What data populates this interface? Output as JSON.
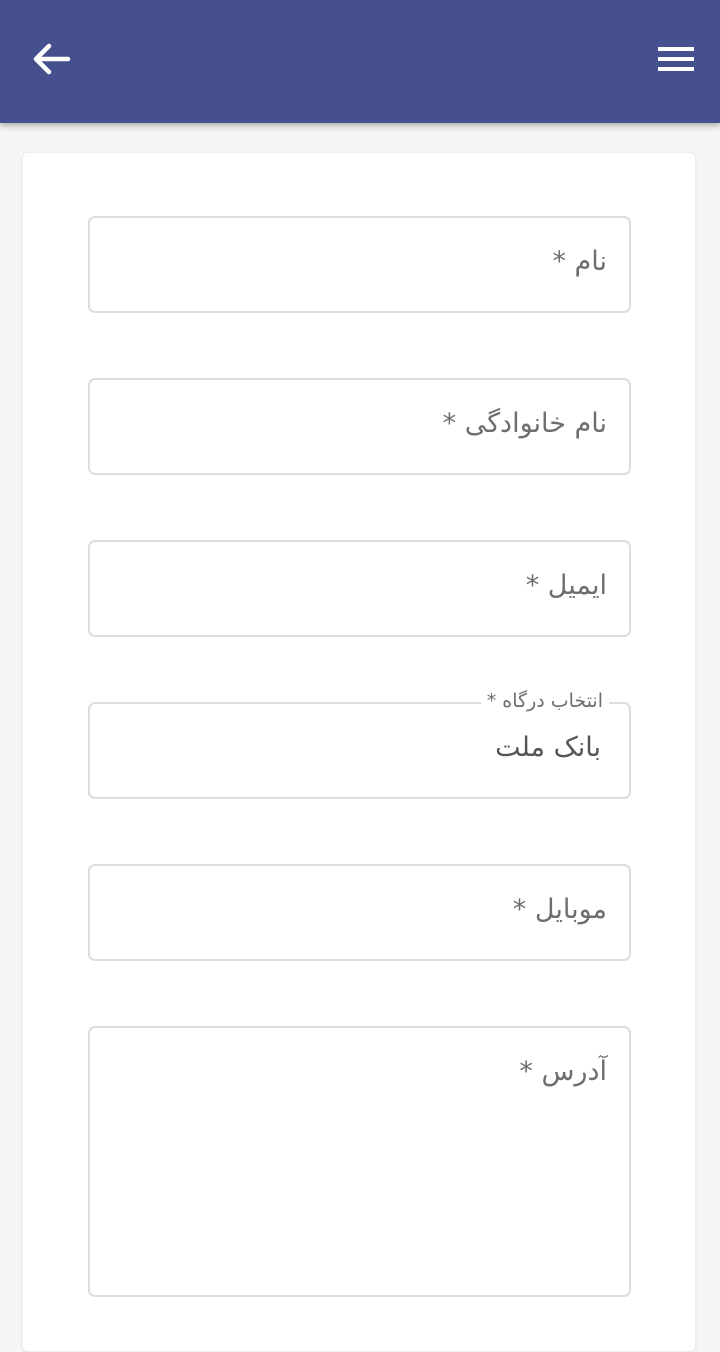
{
  "app_bar": {
    "background": "#46508f",
    "back_icon": "arrow-left-icon",
    "menu_icon": "hamburger-menu-icon"
  },
  "form": {
    "first_name": {
      "placeholder": "نام *"
    },
    "last_name": {
      "placeholder": "نام خانوادگی *"
    },
    "email": {
      "placeholder": "ایمیل *"
    },
    "gateway": {
      "label": "انتخاب درگاه *",
      "value": "بانک ملت"
    },
    "mobile": {
      "placeholder": "موبایل *"
    },
    "address": {
      "placeholder": "آدرس *"
    }
  }
}
